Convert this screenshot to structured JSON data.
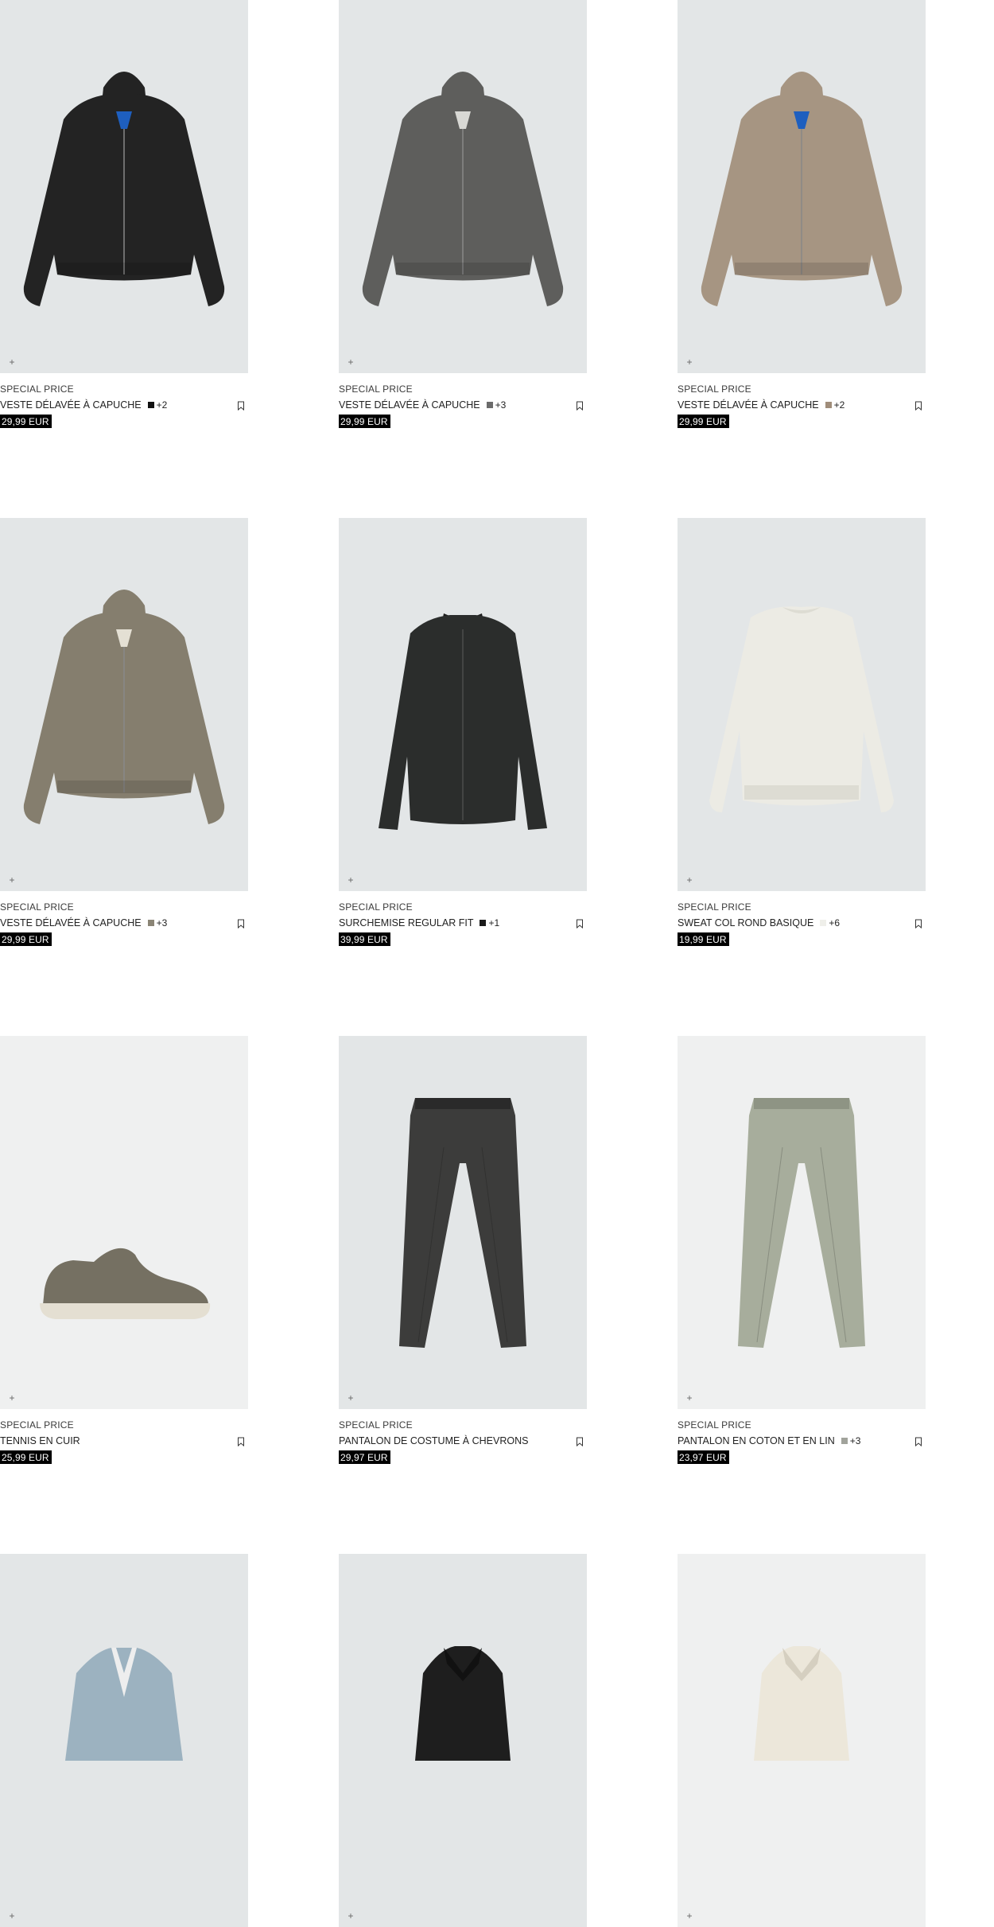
{
  "products": [
    {
      "tag": "SPECIAL PRICE",
      "name": "VESTE DÉLAVÉE À CAPUCHE",
      "color": "#111111",
      "more": "+2",
      "price": "29,99 EUR",
      "kind": "hoodie",
      "bg": "#e3e6e7",
      "fill": "#232323",
      "accent": "#1e5fbf"
    },
    {
      "tag": "SPECIAL PRICE",
      "name": "VESTE DÉLAVÉE À CAPUCHE",
      "color": "#6b6b6b",
      "more": "+3",
      "price": "29,99 EUR",
      "kind": "hoodie",
      "bg": "#e3e6e7",
      "fill": "#5e5e5c",
      "accent": "#d8d8d4"
    },
    {
      "tag": "SPECIAL PRICE",
      "name": "VESTE DÉLAVÉE À CAPUCHE",
      "color": "#a08d7a",
      "more": "+2",
      "price": "29,99 EUR",
      "kind": "hoodie",
      "bg": "#e3e6e7",
      "fill": "#a69582",
      "accent": "#1e5fbf"
    },
    {
      "tag": "SPECIAL PRICE",
      "name": "VESTE DÉLAVÉE À CAPUCHE",
      "color": "#8a8475",
      "more": "+3",
      "price": "29,99 EUR",
      "kind": "hoodie",
      "bg": "#e3e6e7",
      "fill": "#857e6e",
      "accent": "#e4e0d4"
    },
    {
      "tag": "SPECIAL PRICE",
      "name": "SURCHEMISE REGULAR FIT",
      "color": "#1a1a1a",
      "more": "+1",
      "price": "39,99 EUR",
      "kind": "shirt",
      "bg": "#e3e6e7",
      "fill": "#2b2d2c",
      "accent": "#bbbbbb"
    },
    {
      "tag": "SPECIAL PRICE",
      "name": "SWEAT COL ROND BASIQUE",
      "color": "#efefea",
      "more": "+6",
      "price": "19,99 EUR",
      "kind": "sweat",
      "bg": "#e3e6e7",
      "fill": "#ecebe4",
      "accent": "#dddcd3"
    },
    {
      "tag": "SPECIAL PRICE",
      "name": "TENNIS EN CUIR",
      "color": "",
      "more": "",
      "price": "25,99 EUR",
      "kind": "shoe",
      "bg": "#eff0f0",
      "fill": "#757062",
      "accent": "#e4dfd2"
    },
    {
      "tag": "SPECIAL PRICE",
      "name": "PANTALON DE COSTUME À CHEVRONS",
      "color": "",
      "more": "",
      "price": "29,97 EUR",
      "kind": "pants",
      "bg": "#e3e6e7",
      "fill": "#3c3c3b",
      "accent": "#2a2a2a"
    },
    {
      "tag": "SPECIAL PRICE",
      "name": "PANTALON EN COTON ET EN LIN",
      "color": "#a1a39b",
      "more": "+3",
      "price": "23,97 EUR",
      "kind": "pants2",
      "bg": "#eff0f0",
      "fill": "#a7ad9c",
      "accent": "#8e9484"
    },
    {
      "tag": "",
      "name": "",
      "color": "",
      "more": "",
      "price": "",
      "kind": "blazer",
      "bg": "#e3e6e7",
      "fill": "#9cb2c0",
      "accent": "#eeeeee"
    },
    {
      "tag": "",
      "name": "",
      "color": "",
      "more": "",
      "price": "",
      "kind": "collar",
      "bg": "#e3e6e7",
      "fill": "#1e1e1e",
      "accent": "#111111"
    },
    {
      "tag": "",
      "name": "",
      "color": "",
      "more": "",
      "price": "",
      "kind": "collar",
      "bg": "#eff0f0",
      "fill": "#ece7da",
      "accent": "#d5cfc0"
    }
  ],
  "icons": {
    "add": "plus-icon",
    "bookmark": "bookmark-icon"
  },
  "add_glyph": "+"
}
